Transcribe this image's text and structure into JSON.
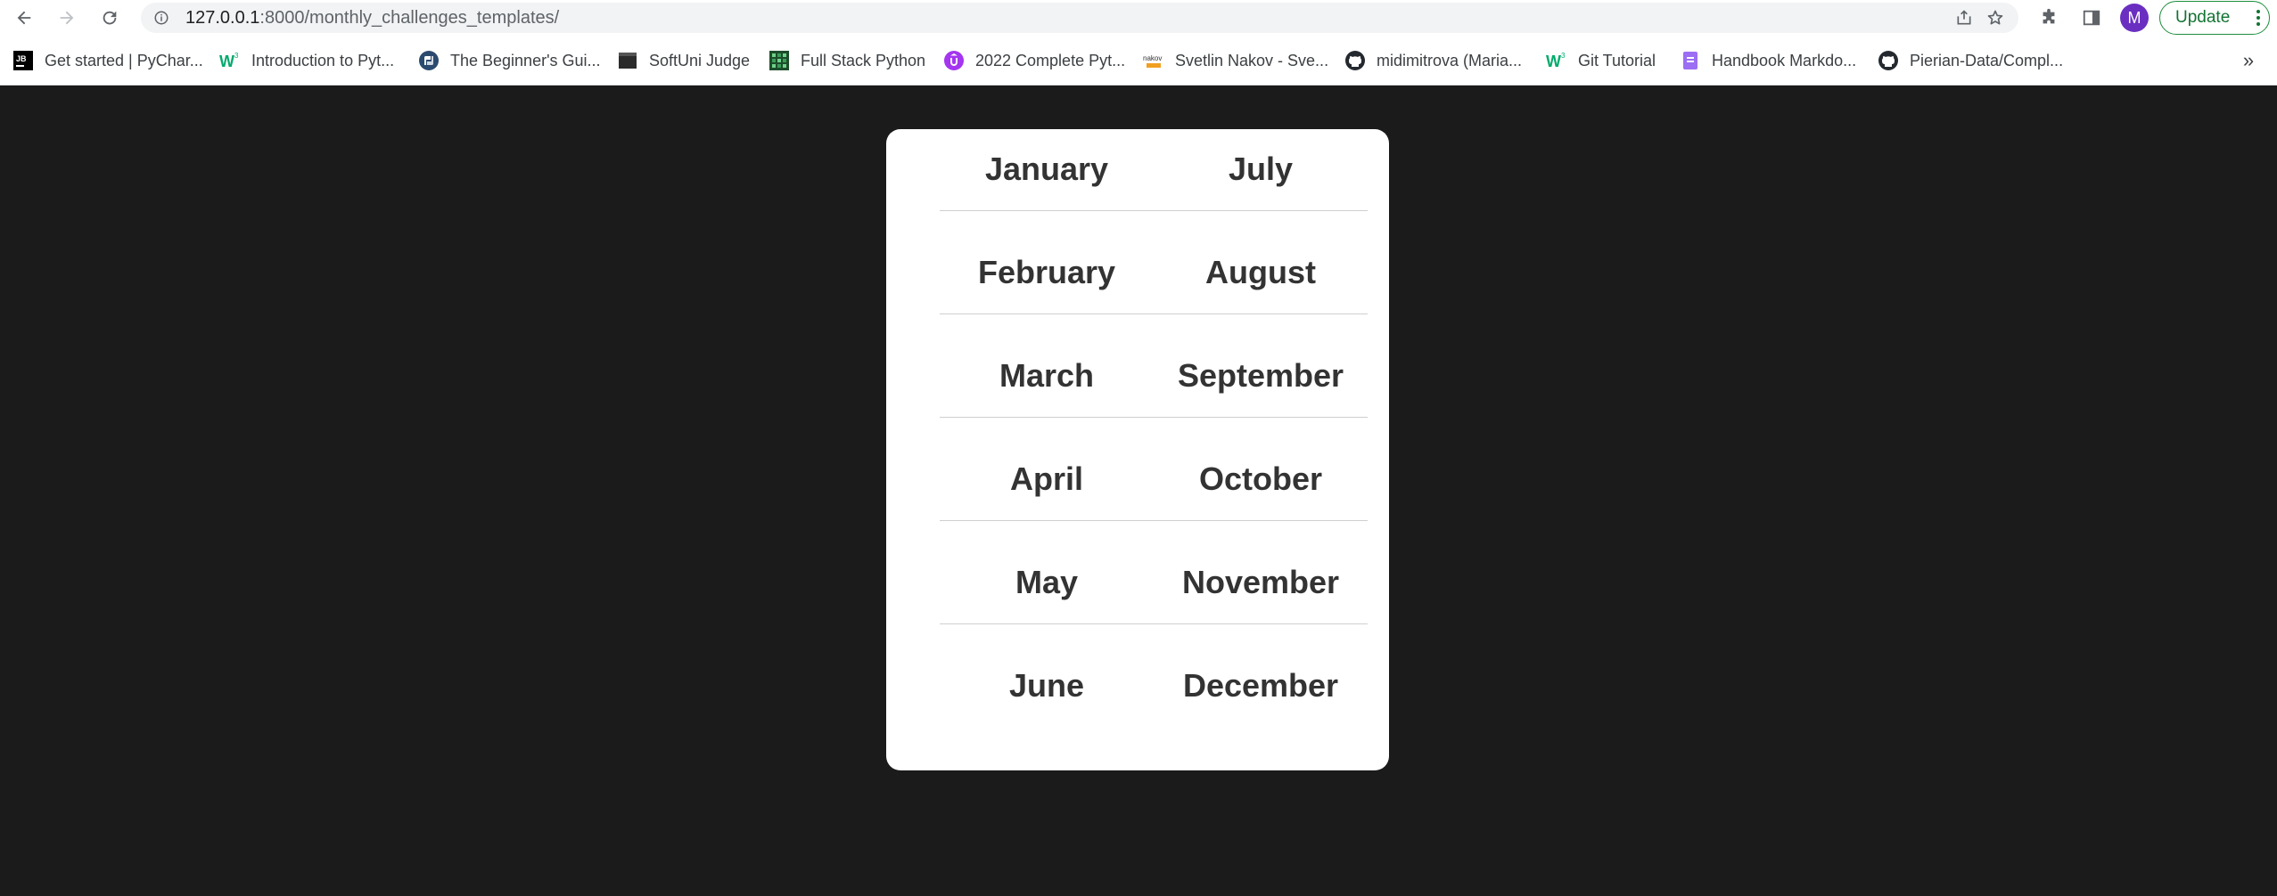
{
  "browser": {
    "url_host": "127.0.0.1",
    "url_rest": ":8000/monthly_challenges_templates/",
    "update_label": "Update",
    "avatar_letter": "M",
    "bookmarks": [
      {
        "label": "Get started | PyChar...",
        "icon": "jetbrains-icon"
      },
      {
        "label": "Introduction to Pyt...",
        "icon": "w3schools-icon"
      },
      {
        "label": "The Beginner's Gui...",
        "icon": "python-icon"
      },
      {
        "label": "SoftUni Judge",
        "icon": "softuni-judge-icon"
      },
      {
        "label": "Full Stack Python",
        "icon": "fullstackpython-icon"
      },
      {
        "label": "2022 Complete Pyt...",
        "icon": "udemy-icon"
      },
      {
        "label": "Svetlin Nakov - Sve...",
        "icon": "nakov-icon"
      },
      {
        "label": "midimitrova (Maria...",
        "icon": "github-icon"
      },
      {
        "label": "Git Tutorial",
        "icon": "w3schools-icon"
      },
      {
        "label": "Handbook Markdo...",
        "icon": "handbook-icon"
      },
      {
        "label": "Pierian-Data/Compl...",
        "icon": "github-icon"
      }
    ],
    "more_label": "»"
  },
  "months": [
    [
      "January",
      "July"
    ],
    [
      "February",
      "August"
    ],
    [
      "March",
      "September"
    ],
    [
      "April",
      "October"
    ],
    [
      "May",
      "November"
    ],
    [
      "June",
      "December"
    ]
  ],
  "colors": {
    "page_bg": "#1b1b1b",
    "card_bg": "#ffffff",
    "month_text": "#333333"
  }
}
